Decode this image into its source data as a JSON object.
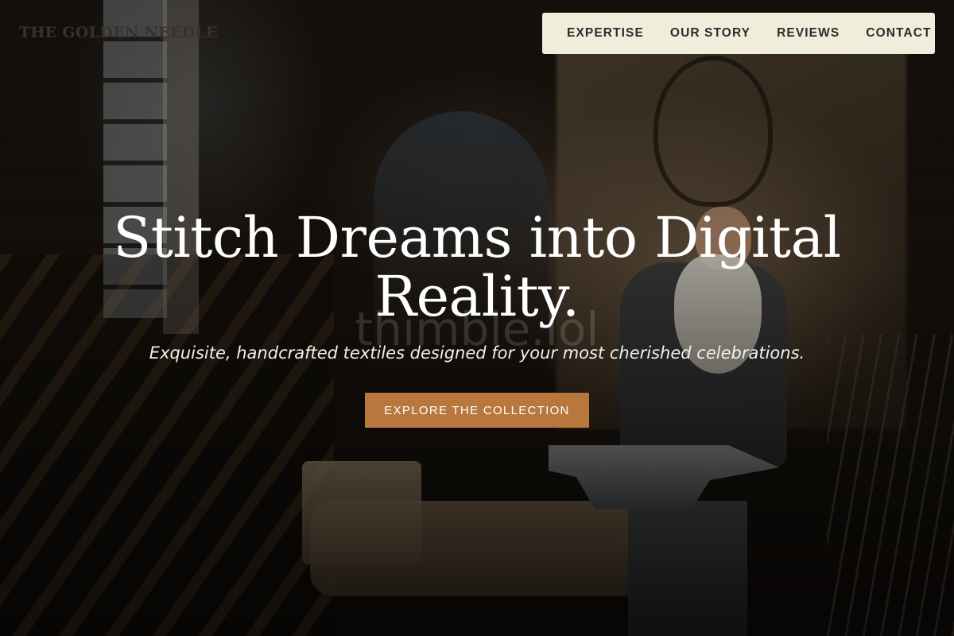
{
  "brand": {
    "name": "THE GOLDEN NEEDLE"
  },
  "nav": {
    "items": [
      {
        "label": "EXPERTISE"
      },
      {
        "label": "OUR STORY"
      },
      {
        "label": "REVIEWS"
      },
      {
        "label": "CONTACT"
      }
    ]
  },
  "hero": {
    "headline_line1": "Stitch Dreams into Digital",
    "headline_line2": "Reality.",
    "subtitle": "Exquisite, handcrafted textiles designed for your most cherished celebrations.",
    "cta_label": "EXPLORE THE COLLECTION",
    "watermark": "thimble.lol",
    "background_image": "blacksmith-workshop-photo"
  },
  "colors": {
    "nav_background": "#efeedb",
    "cta_background": "#b8773c",
    "headline": "#ffffff",
    "brand_text": "#3a3127"
  }
}
